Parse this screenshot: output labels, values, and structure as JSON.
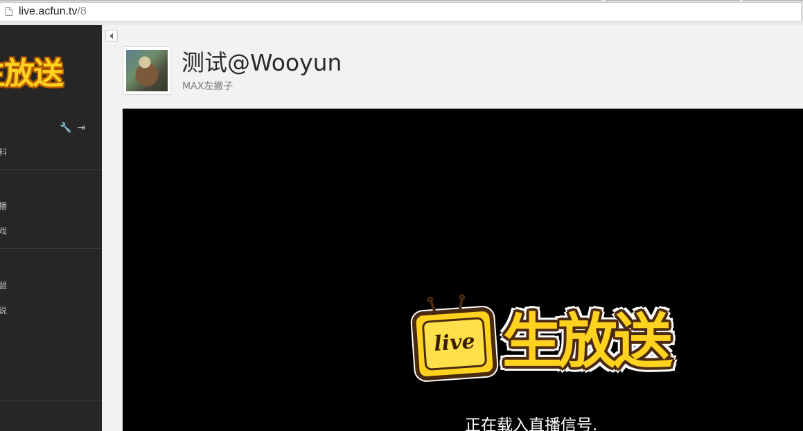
{
  "address_bar": {
    "host": "live.acfun.tv",
    "path": "/8"
  },
  "sidebar": {
    "logo_text": "生放送",
    "tools": [
      {
        "icon": "wrench-icon",
        "glyph": "🔧"
      },
      {
        "icon": "logout-icon",
        "glyph": "⇥"
      }
    ],
    "items": [
      "料",
      "播",
      "戏",
      "盟",
      "说"
    ]
  },
  "channel": {
    "title": "测试@Wooyun",
    "subtitle": "MAX左撇子"
  },
  "player": {
    "badge_text": "live",
    "logo_text": "生放送",
    "status_text": "正在载入直播信号."
  }
}
